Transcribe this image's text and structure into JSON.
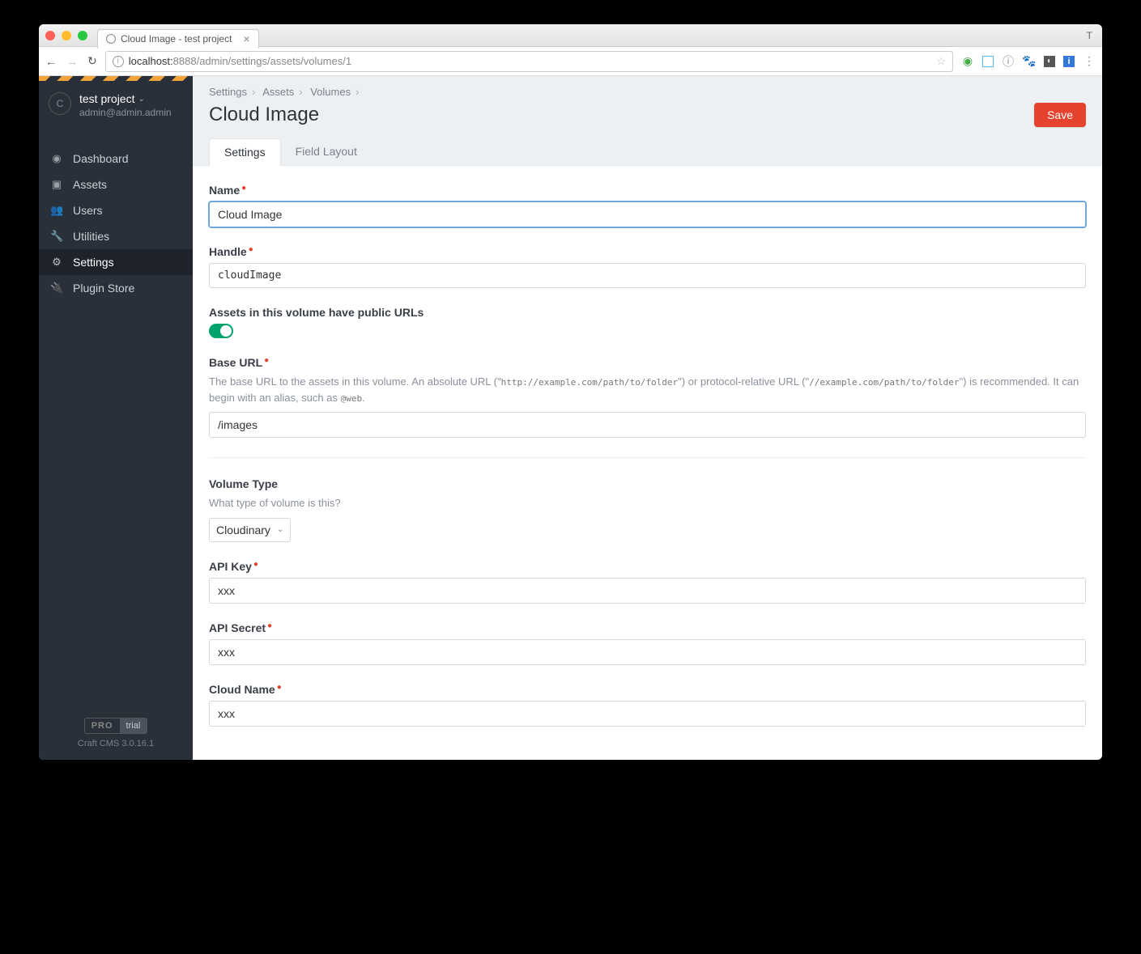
{
  "browser": {
    "tab_title": "Cloud Image - test project",
    "profile_badge": "T",
    "url_host": "localhost:",
    "url_path": "8888/admin/settings/assets/volumes/1"
  },
  "sidebar": {
    "project_initial": "C",
    "project_name": "test project",
    "project_email": "admin@admin.admin",
    "items": [
      {
        "label": "Dashboard"
      },
      {
        "label": "Assets"
      },
      {
        "label": "Users"
      },
      {
        "label": "Utilities"
      },
      {
        "label": "Settings"
      },
      {
        "label": "Plugin Store"
      }
    ],
    "pro_label": "PRO",
    "trial_label": "trial",
    "version": "Craft CMS 3.0.16.1"
  },
  "breadcrumbs": {
    "a": "Settings",
    "b": "Assets",
    "c": "Volumes"
  },
  "page": {
    "title": "Cloud Image",
    "save_label": "Save"
  },
  "tabs": {
    "settings": "Settings",
    "field_layout": "Field Layout"
  },
  "form": {
    "name_label": "Name",
    "name_value": "Cloud Image",
    "handle_label": "Handle",
    "handle_value": "cloudImage",
    "public_urls_label": "Assets in this volume have public URLs",
    "base_url_label": "Base URL",
    "base_url_help_pre": "The base URL to the assets in this volume. An absolute URL (\"",
    "base_url_help_code1": "http://example.com/path/to/folder",
    "base_url_help_mid": "\") or protocol-relative URL (\"",
    "base_url_help_code2": "//example.com/path/to/folder",
    "base_url_help_post": "\") is recommended. It can begin with an alias, such as ",
    "base_url_help_code3": "@web",
    "base_url_value": "/images",
    "volume_type_label": "Volume Type",
    "volume_type_help": "What type of volume is this?",
    "volume_type_value": "Cloudinary",
    "api_key_label": "API Key",
    "api_key_value": "xxx",
    "api_secret_label": "API Secret",
    "api_secret_value": "xxx",
    "cloud_name_label": "Cloud Name",
    "cloud_name_value": "xxx"
  }
}
